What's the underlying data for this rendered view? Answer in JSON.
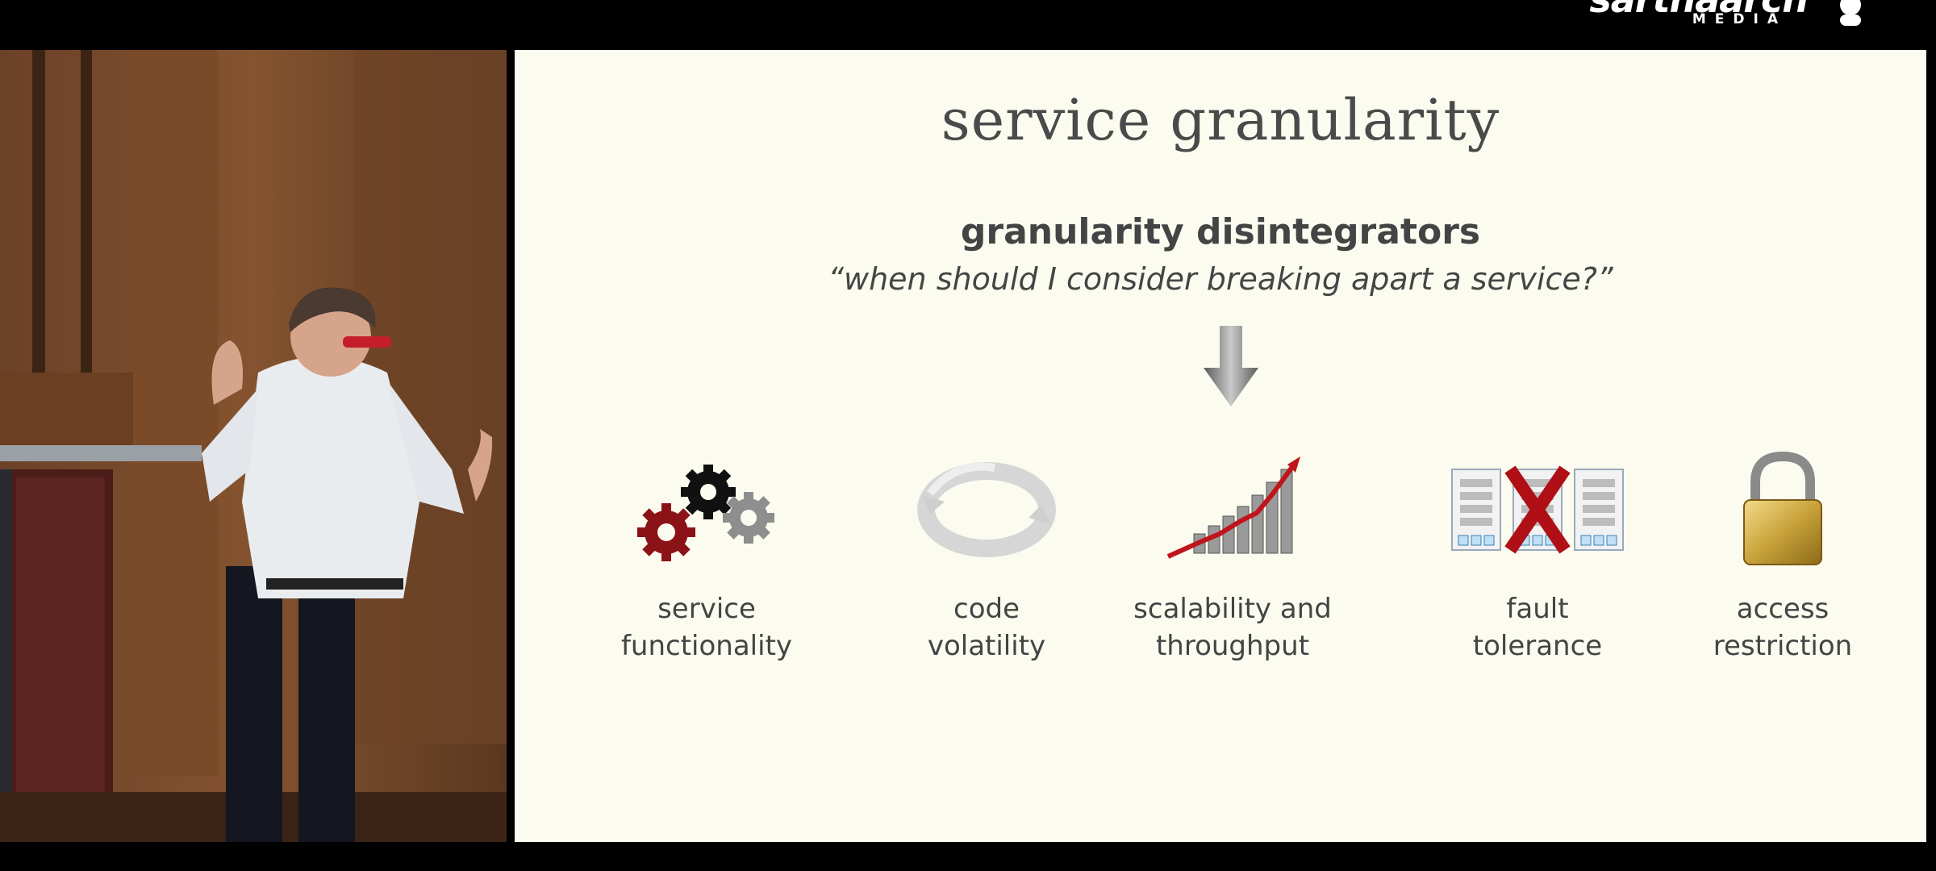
{
  "watermark": {
    "brand": "sarthaarch",
    "sub": "MEDIA"
  },
  "slide": {
    "title": "service granularity",
    "subtitle": "granularity disintegrators",
    "question": "“when should I consider breaking apart a service?”"
  },
  "disintegrators": [
    {
      "label": "service\nfunctionality",
      "icon": "gears-icon"
    },
    {
      "label": "code\nvolatility",
      "icon": "cycle-icon"
    },
    {
      "label": "scalability and\nthroughput",
      "icon": "growth-chart-icon"
    },
    {
      "label": "fault\ntolerance",
      "icon": "fault-x-icon"
    },
    {
      "label": "access\nrestriction",
      "icon": "padlock-icon"
    }
  ],
  "colors": {
    "slide_background": "#fcfbf0",
    "text": "#444444",
    "accent_red": "#c0141c"
  }
}
